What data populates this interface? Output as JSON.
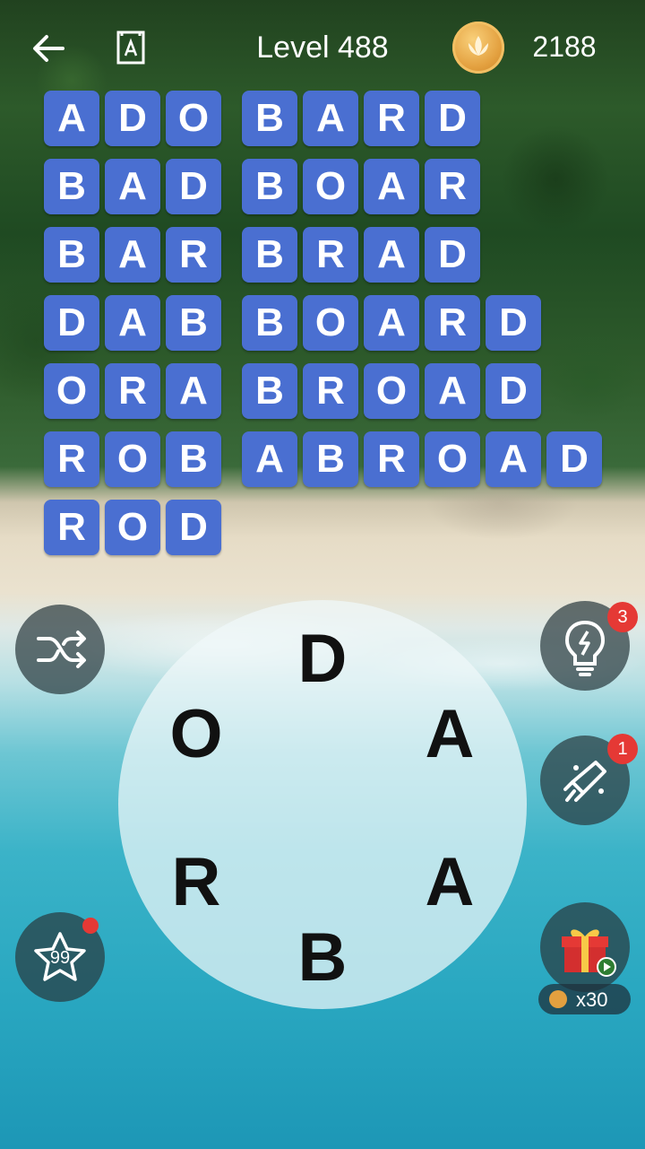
{
  "header": {
    "level": "Level 488",
    "coins": "2188"
  },
  "words": [
    [
      "ADO",
      "BARD"
    ],
    [
      "BAD",
      "BOAR"
    ],
    [
      "BAR",
      "BRAD"
    ],
    [
      "DAB",
      "BOARD"
    ],
    [
      "ORA",
      "BROAD"
    ],
    [
      "ROB",
      "ABROAD"
    ],
    [
      "ROD"
    ]
  ],
  "wheel_letters": {
    "top": "D",
    "upper_left": "O",
    "upper_right": "A",
    "lower_left": "R",
    "lower_right": "A",
    "bottom": "B"
  },
  "buttons": {
    "shuffle_icon": "shuffle-icon",
    "hint_badge": "3",
    "rocket_badge": "1",
    "star_count": "99",
    "gift_reward": "x30"
  },
  "colors": {
    "tile": "#4a6fd1",
    "badge": "#e53935"
  }
}
